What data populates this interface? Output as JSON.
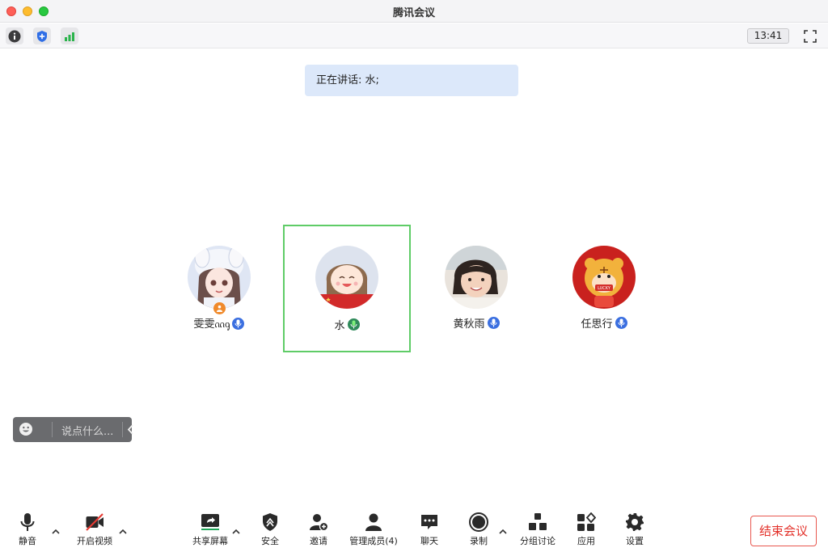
{
  "window": {
    "title": "腾讯会议"
  },
  "infobar": {
    "time": "13:41"
  },
  "speaking": {
    "label": "正在讲话: 水;"
  },
  "participants": [
    {
      "name": "雯雯ᦶᧁ",
      "active": false
    },
    {
      "name": "水",
      "active": true
    },
    {
      "name": "黄秋雨",
      "active": false
    },
    {
      "name": "任思行",
      "active": false
    }
  ],
  "chat": {
    "placeholder": "说点什么..."
  },
  "toolbar": {
    "mute": "静音",
    "video": "开启视频",
    "share": "共享屏幕",
    "security": "安全",
    "invite": "邀请",
    "members": "管理成员(4)",
    "chat": "聊天",
    "record": "录制",
    "breakout": "分组讨论",
    "apps": "应用",
    "settings": "设置",
    "end": "结束会议"
  },
  "colors": {
    "active_border": "#5fcc67",
    "end_red": "#e3312a",
    "mic_blue": "#3b6fe0",
    "mic_green": "#2bb34b"
  }
}
